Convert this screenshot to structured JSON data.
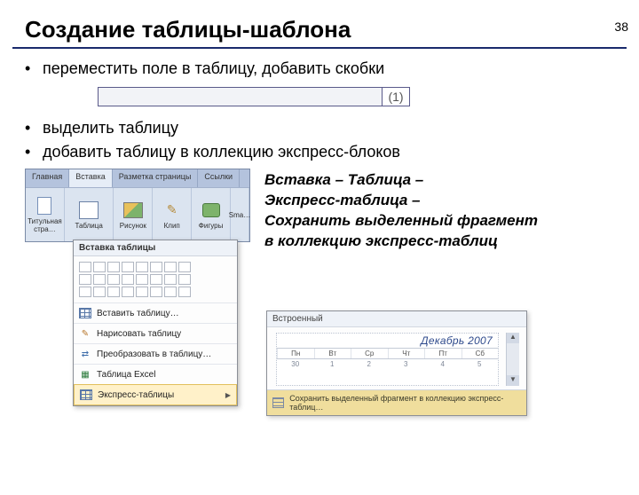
{
  "page_number": "38",
  "title": "Создание таблицы-шаблона",
  "bullets": {
    "b1": "переместить поле в таблицу, добавить скобки",
    "b2": "выделить таблицу",
    "b3": "добавить таблицу в коллекцию экспресс-блоков"
  },
  "field_example": {
    "right": "(1)"
  },
  "ribbon": {
    "tabs": {
      "home": "Главная",
      "insert": "Вставка",
      "layout": "Разметка страницы",
      "refs": "Ссылки"
    },
    "buttons": {
      "cover": "Титульная\nстра…",
      "table": "Таблица",
      "picture": "Рисунок",
      "clip": "Клип",
      "shapes": "Фигуры",
      "smart": "Sma…"
    }
  },
  "dropdown": {
    "header": "Вставка таблицы",
    "items": {
      "insert": "Вставить таблицу…",
      "draw": "Нарисовать таблицу",
      "convert": "Преобразовать в таблицу…",
      "excel": "Таблица Excel",
      "express": "Экспресс-таблицы"
    }
  },
  "path_text": {
    "l1": "Вставка – Таблица –",
    "l2": "Экспресс-таблица –",
    "l3": "Сохранить выделенный фрагмент",
    "l4": "в коллекцию экспресс-таблиц"
  },
  "preview": {
    "header": "Встроенный",
    "month": "Декабрь 2007",
    "days": {
      "d1": "Пн",
      "d2": "Вт",
      "d3": "Ср",
      "d4": "Чт",
      "d5": "Пт",
      "d6": "Сб"
    },
    "nums": {
      "n1": "30",
      "n2": "1",
      "n3": "2",
      "n4": "3",
      "n5": "4",
      "n6": "5"
    },
    "save": "Сохранить выделенный фрагмент в коллекцию экспресс-таблиц…"
  }
}
